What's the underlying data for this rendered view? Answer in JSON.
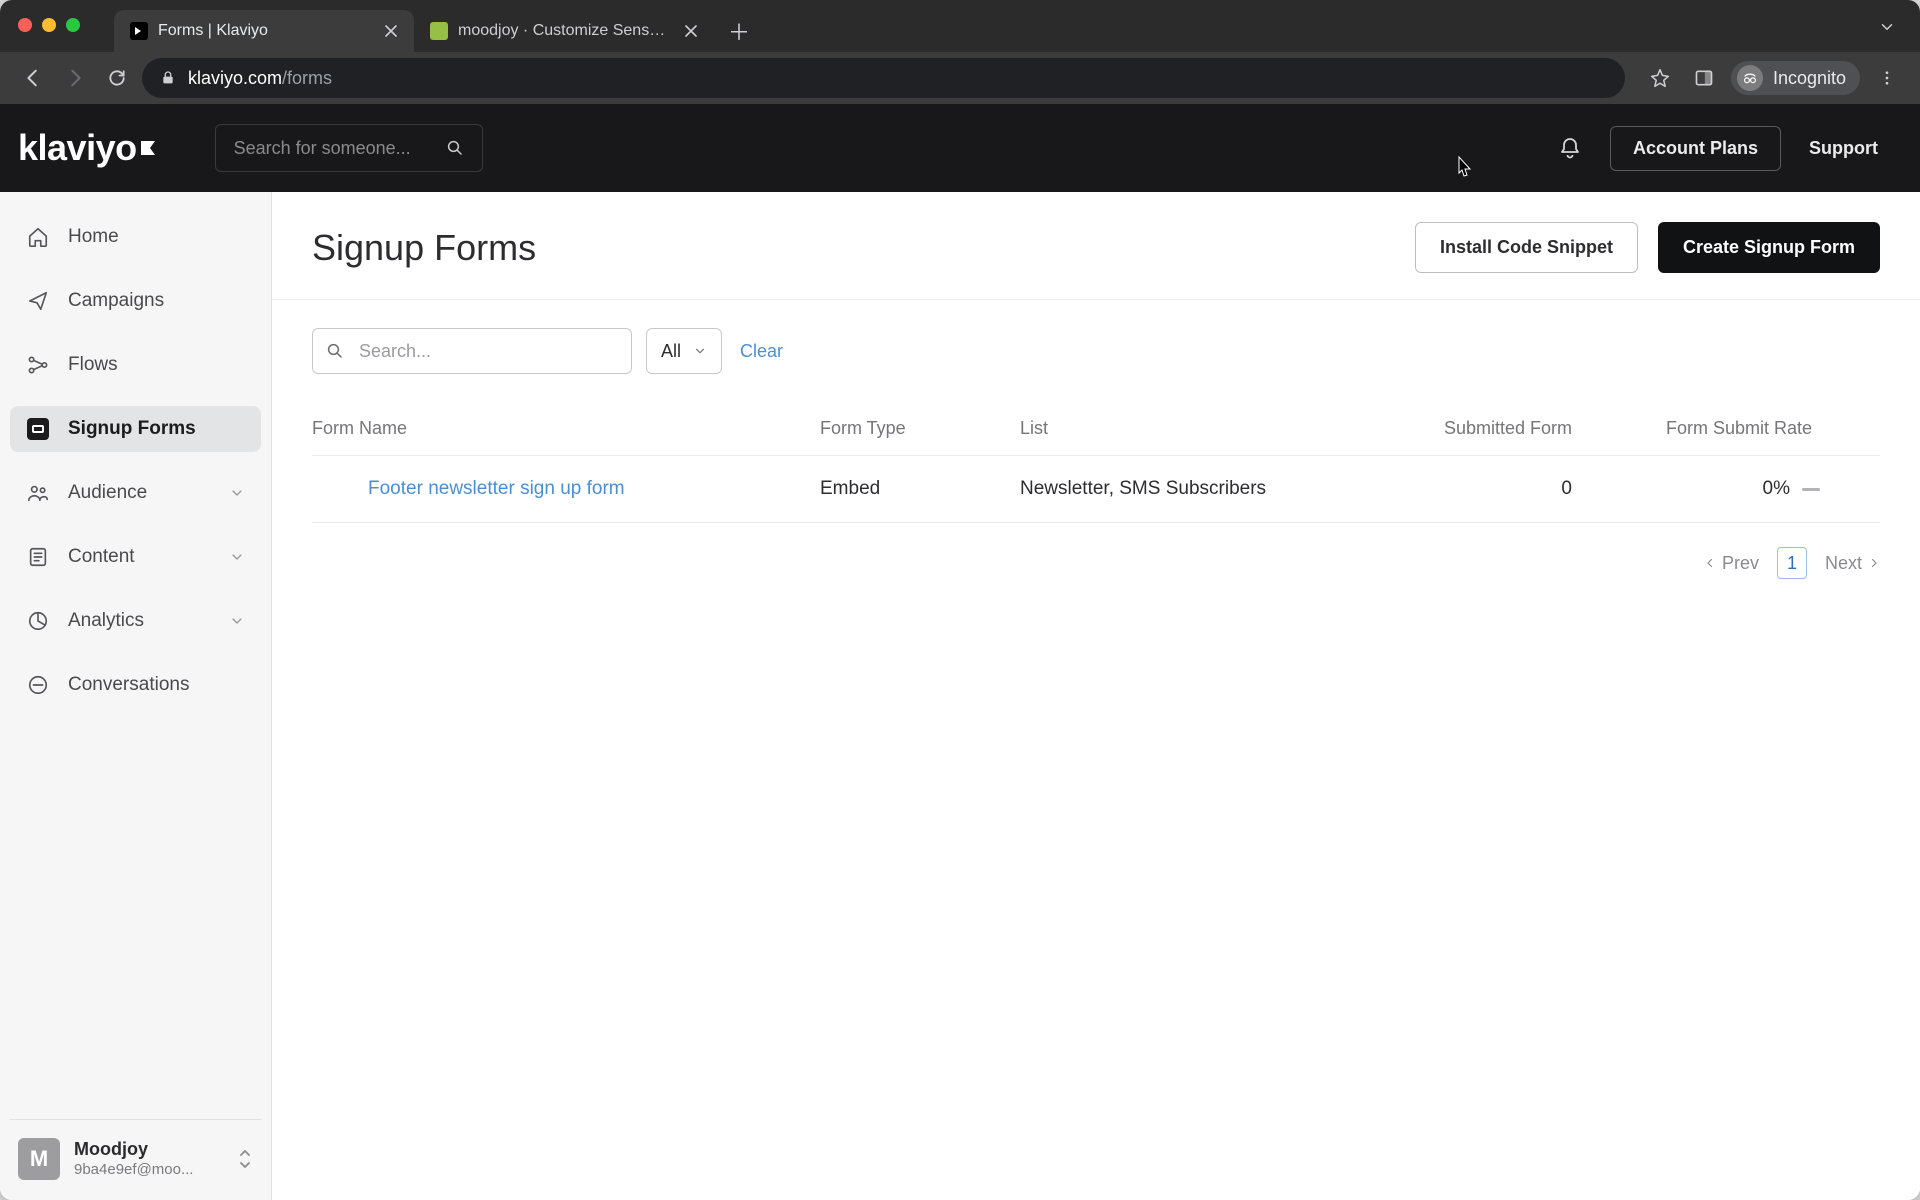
{
  "browser": {
    "tabs": [
      {
        "title": "Forms | Klaviyo",
        "favicon": "klaviyo"
      },
      {
        "title": "moodjoy · Customize Sense · S",
        "favicon": "shopify"
      }
    ],
    "url_host": "klaviyo.com",
    "url_path": "/forms",
    "incognito_label": "Incognito"
  },
  "header": {
    "logo_text": "klaviyo",
    "search_placeholder": "Search for someone...",
    "account_plans": "Account Plans",
    "support": "Support"
  },
  "sidebar": {
    "items": [
      {
        "label": "Home"
      },
      {
        "label": "Campaigns"
      },
      {
        "label": "Flows"
      },
      {
        "label": "Signup Forms"
      },
      {
        "label": "Audience"
      },
      {
        "label": "Content"
      },
      {
        "label": "Analytics"
      },
      {
        "label": "Conversations"
      }
    ],
    "account": {
      "avatar_initial": "M",
      "name": "Moodjoy",
      "email": "9ba4e9ef@moo..."
    }
  },
  "page": {
    "title": "Signup Forms",
    "actions": {
      "install": "Install Code Snippet",
      "create": "Create Signup Form"
    },
    "filters": {
      "search_placeholder": "Search...",
      "type_label": "All",
      "clear": "Clear"
    },
    "columns": {
      "name": "Form Name",
      "type": "Form Type",
      "list": "List",
      "submitted": "Submitted Form",
      "rate": "Form Submit Rate"
    },
    "rows": [
      {
        "status": "live",
        "name": "Footer newsletter sign up form",
        "type": "Embed",
        "list": "Newsletter, SMS Subscribers",
        "submitted": "0",
        "rate": "0%"
      }
    ],
    "pager": {
      "prev": "Prev",
      "page": "1",
      "next": "Next"
    }
  }
}
